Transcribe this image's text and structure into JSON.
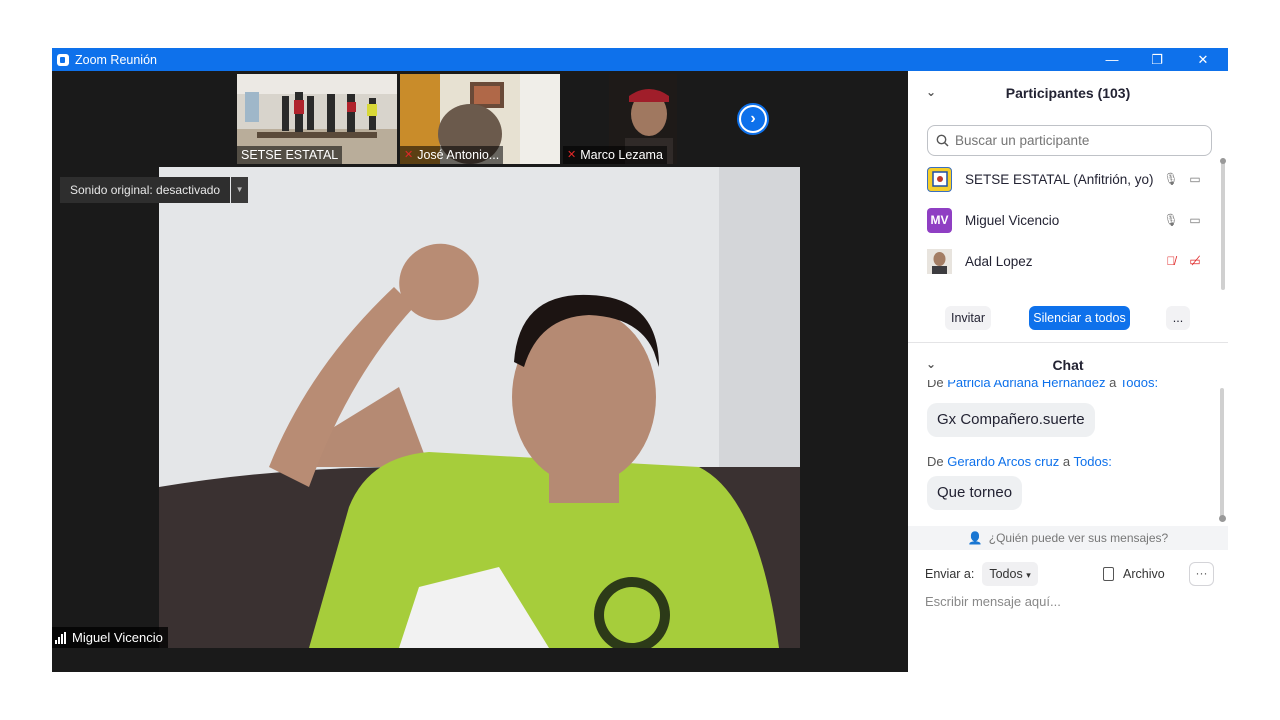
{
  "window": {
    "title": "Zoom Reunión",
    "controls": {
      "minimize": "—",
      "restore": "❐",
      "close": "✕"
    },
    "accent": "#0e71eb"
  },
  "thumbnails": [
    {
      "name": "SETSE ESTATAL",
      "muted": false
    },
    {
      "name": "José Antonio...",
      "muted": true
    },
    {
      "name": "Marco Lezama",
      "muted": true
    }
  ],
  "video": {
    "sound_button": "Sonido original: desactivado",
    "active_speaker": "Miguel Vicencio",
    "next_arrow": "›"
  },
  "participants_panel": {
    "title": "Participantes (103)",
    "search_placeholder": "Buscar un participante",
    "participants": [
      {
        "name": "SETSE ESTATAL (Anfitrión, yo)",
        "avatar": "logo",
        "mic": "on",
        "video": "on"
      },
      {
        "name": "Miguel Vicencio",
        "avatar": "MV",
        "avatar_color": "#8f3fc3",
        "mic": "on",
        "video": "on"
      },
      {
        "name": "Adal Lopez",
        "avatar": "photo",
        "mic": "off",
        "video": "off"
      }
    ],
    "buttons": {
      "invite": "Invitar",
      "mute_all": "Silenciar a todos",
      "more": "..."
    }
  },
  "chat_panel": {
    "title": "Chat",
    "messages": [
      {
        "prefix": "De",
        "sender": "Patricia Adriana Hernández",
        "connector": "a",
        "recipient": "Todos:",
        "text": "Gx Compañero.suerte"
      },
      {
        "prefix": "De",
        "sender": "Gerardo Arcos cruz",
        "connector": "a",
        "recipient": "Todos:",
        "text": "Que torneo"
      }
    ],
    "who_can_see": "¿Quién puede ver sus mensajes?",
    "send_to_label": "Enviar a:",
    "send_to_value": "Todos",
    "file_label": "Archivo",
    "more": "···",
    "input_placeholder": "Escribir mensaje aquí..."
  }
}
